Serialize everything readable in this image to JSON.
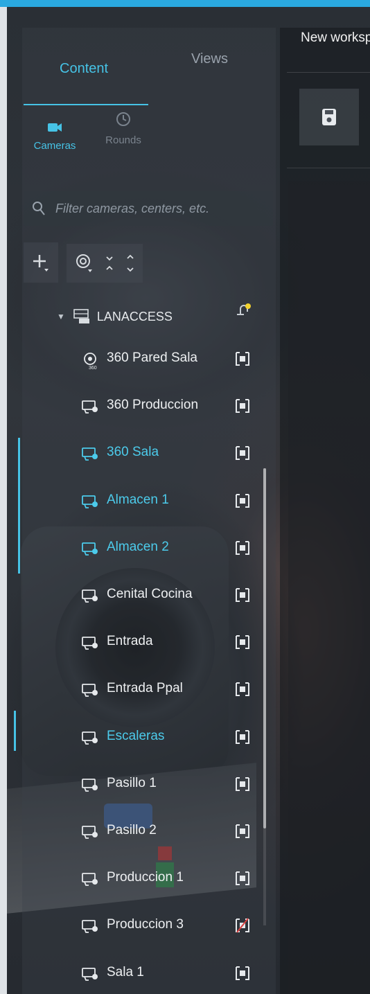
{
  "workspace": {
    "title": "New worksp"
  },
  "sidebar": {
    "tabs": [
      {
        "label": "Content",
        "active": true
      },
      {
        "label": "Views",
        "active": false
      }
    ],
    "subtabs": [
      {
        "label": "Cameras",
        "icon": "camera-icon",
        "active": true
      },
      {
        "label": "Rounds",
        "icon": "rounds-icon",
        "active": false
      }
    ],
    "search": {
      "placeholder": "Filter cameras, centers, etc."
    },
    "tree": {
      "root_label": "LANACCESS",
      "items": [
        {
          "label": "360 Pared Sala",
          "icon": "360-camera-icon",
          "active": false
        },
        {
          "label": "360 Produccion",
          "icon": "camera-icon",
          "active": false
        },
        {
          "label": "360 Sala",
          "icon": "camera-icon",
          "active": true
        },
        {
          "label": "Almacen 1",
          "icon": "camera-icon",
          "active": true
        },
        {
          "label": "Almacen 2",
          "icon": "camera-icon",
          "active": true
        },
        {
          "label": "Cenital Cocina",
          "icon": "camera-icon",
          "active": false
        },
        {
          "label": "Entrada",
          "icon": "camera-icon",
          "active": false
        },
        {
          "label": "Entrada Ppal",
          "icon": "camera-icon",
          "active": false
        },
        {
          "label": "Escaleras",
          "icon": "camera-icon",
          "active": true
        },
        {
          "label": "Pasillo 1",
          "icon": "camera-icon",
          "active": false
        },
        {
          "label": "Pasillo 2",
          "icon": "camera-icon",
          "active": false
        },
        {
          "label": "Produccion 1",
          "icon": "camera-icon",
          "active": false
        },
        {
          "label": "Produccion 3",
          "icon": "camera-icon",
          "active": false
        },
        {
          "label": "Sala 1",
          "icon": "camera-icon",
          "active": false
        }
      ]
    }
  },
  "colors": {
    "accent": "#46c3e6",
    "topbar": "#2aa9e0",
    "alert": "#f2d22e"
  }
}
